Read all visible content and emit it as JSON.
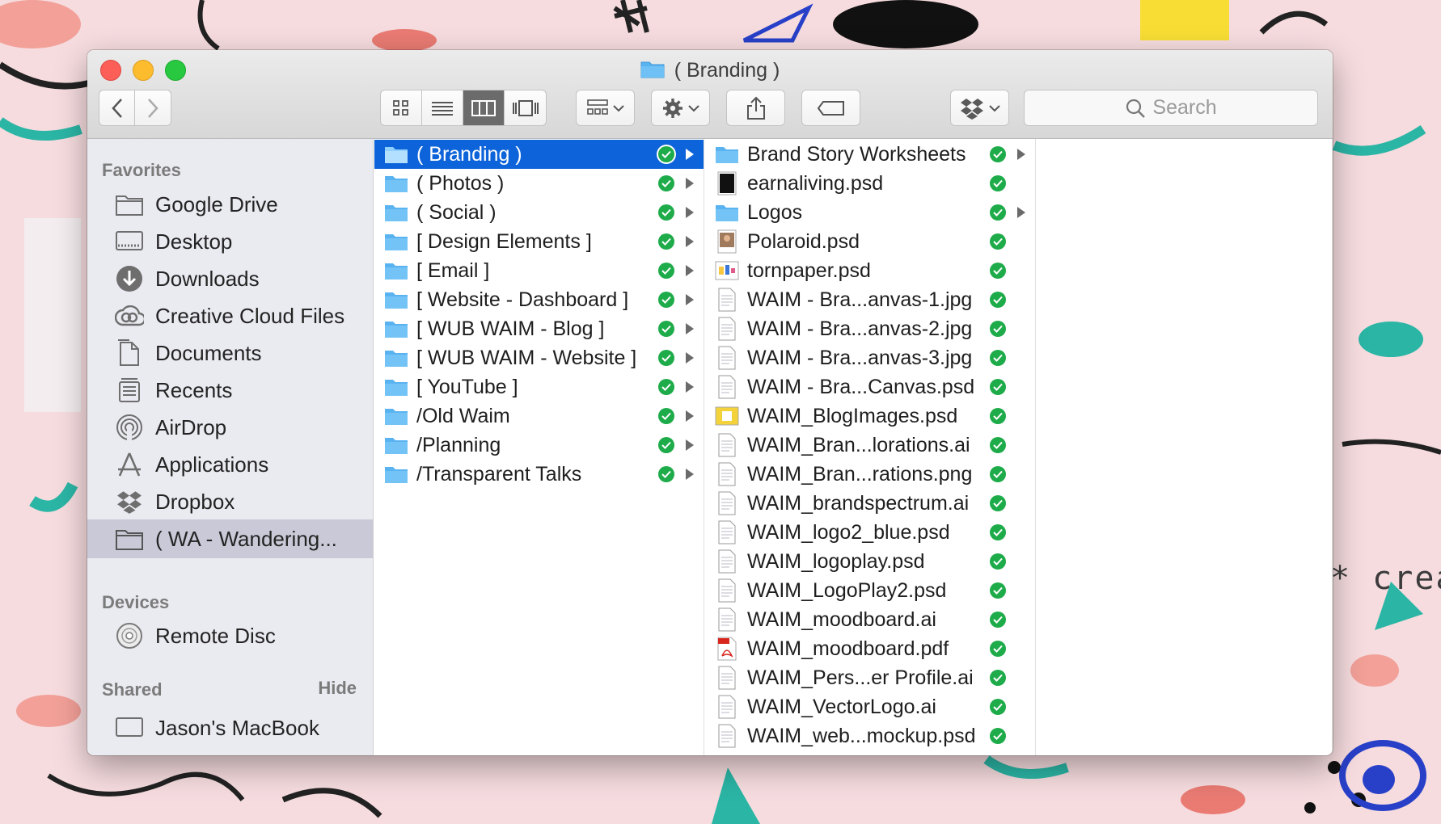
{
  "window": {
    "title": "( Branding )"
  },
  "toolbar": {
    "search_placeholder": "Search"
  },
  "sidebar": {
    "favorites_label": "Favorites",
    "favorites": [
      {
        "label": "Google Drive",
        "icon": "folder-icon"
      },
      {
        "label": "Desktop",
        "icon": "desktop-icon"
      },
      {
        "label": "Downloads",
        "icon": "downloads-icon"
      },
      {
        "label": "Creative Cloud Files",
        "icon": "creative-cloud-icon"
      },
      {
        "label": "Documents",
        "icon": "documents-icon"
      },
      {
        "label": "Recents",
        "icon": "recents-icon"
      },
      {
        "label": "AirDrop",
        "icon": "airdrop-icon"
      },
      {
        "label": "Applications",
        "icon": "applications-icon"
      },
      {
        "label": "Dropbox",
        "icon": "dropbox-icon"
      },
      {
        "label": "( WA - Wandering...",
        "icon": "folder-icon"
      }
    ],
    "devices_label": "Devices",
    "devices": [
      {
        "label": "Remote Disc",
        "icon": "disc-icon"
      }
    ],
    "shared_label": "Shared",
    "shared_hide": "Hide",
    "shared": [
      {
        "label": "Jason's MacBook",
        "icon": "computer-icon"
      }
    ]
  },
  "column1": [
    "( Branding )",
    "( Photos )",
    "( Social )",
    "[ Design Elements ]",
    "[ Email ]",
    "[ Website - Dashboard ]",
    "[ WUB WAIM - Blog ]",
    "[ WUB WAIM - Website ]",
    "[ YouTube ]",
    "/Old Waim",
    "/Planning",
    "/Transparent Talks"
  ],
  "column2": [
    {
      "name": "Brand Story Worksheets",
      "type": "folder"
    },
    {
      "name": "earnaliving.psd",
      "type": "psd-dark"
    },
    {
      "name": "Logos",
      "type": "folder"
    },
    {
      "name": "Polaroid.psd",
      "type": "psd-photo"
    },
    {
      "name": "tornpaper.psd",
      "type": "psd-color"
    },
    {
      "name": "WAIM - Bra...anvas-1.jpg",
      "type": "doc"
    },
    {
      "name": "WAIM - Bra...anvas-2.jpg",
      "type": "doc"
    },
    {
      "name": "WAIM - Bra...anvas-3.jpg",
      "type": "doc"
    },
    {
      "name": "WAIM - Bra...Canvas.psd",
      "type": "doc"
    },
    {
      "name": "WAIM_BlogImages.psd",
      "type": "psd-yellow"
    },
    {
      "name": "WAIM_Bran...lorations.ai",
      "type": "doc"
    },
    {
      "name": "WAIM_Bran...rations.png",
      "type": "doc"
    },
    {
      "name": "WAIM_brandspectrum.ai",
      "type": "doc"
    },
    {
      "name": "WAIM_logo2_blue.psd",
      "type": "doc"
    },
    {
      "name": "WAIM_logoplay.psd",
      "type": "doc"
    },
    {
      "name": "WAIM_LogoPlay2.psd",
      "type": "doc"
    },
    {
      "name": "WAIM_moodboard.ai",
      "type": "doc"
    },
    {
      "name": "WAIM_moodboard.pdf",
      "type": "pdf"
    },
    {
      "name": "WAIM_Pers...er Profile.ai",
      "type": "doc"
    },
    {
      "name": "WAIM_VectorLogo.ai",
      "type": "doc"
    },
    {
      "name": "WAIM_web...mockup.psd",
      "type": "doc"
    }
  ],
  "wallpaper_text": "* crea",
  "colors": {
    "selection": "#0d63d9",
    "sync_check": "#1eab4a",
    "folder_blue": "#5ab3f1"
  }
}
